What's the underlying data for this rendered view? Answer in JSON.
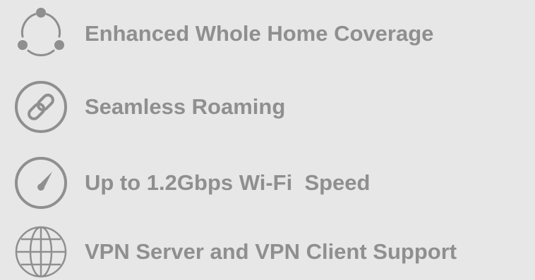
{
  "colors": {
    "background": "#e7e7e7",
    "icon": "#8f8f8f",
    "text": "#8f8f8f"
  },
  "features": [
    {
      "icon": "mesh-network-icon",
      "label": "Enhanced Whole Home Coverage"
    },
    {
      "icon": "link-icon",
      "label": "Seamless Roaming"
    },
    {
      "icon": "speedometer-icon",
      "label": "Up to 1.2Gbps Wi-Fi  Speed"
    },
    {
      "icon": "globe-icon",
      "label": "VPN Server and VPN Client Support"
    }
  ]
}
